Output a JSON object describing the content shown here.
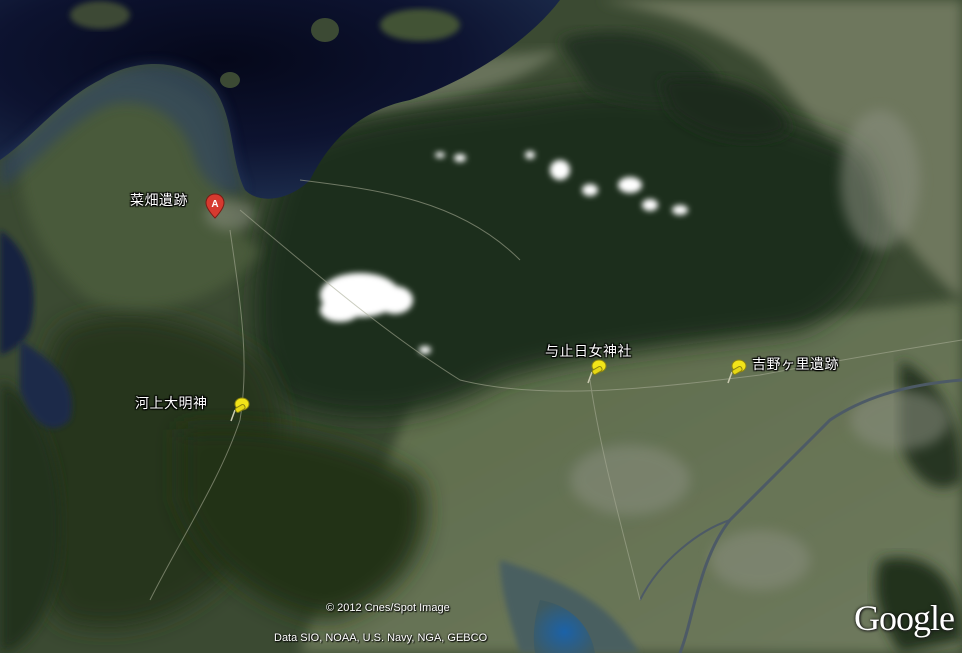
{
  "map": {
    "imagery_type": "satellite",
    "places": [
      {
        "id": "nabatake",
        "label": "菜畑遺跡",
        "marker": "red-pin-A"
      },
      {
        "id": "yodohime",
        "label": "与止日女神社",
        "marker": "yellow-pushpin"
      },
      {
        "id": "yoshinogari",
        "label": "吉野ヶ里遺跡",
        "marker": "yellow-pushpin"
      },
      {
        "id": "kawakami",
        "label": "河上大明神",
        "marker": "yellow-pushpin"
      }
    ],
    "marker_letter": "A",
    "colors": {
      "marker_red": "#d63a2f",
      "pushpin_yellow": "#f2e419",
      "sea_dark": "#0a0d22",
      "forest_dark": "#233320",
      "plain_green": "#5d6b4c"
    }
  },
  "credits": {
    "imagery": "© 2012 Cnes/Spot Image",
    "data": "Data SIO, NOAA, U.S. Navy, NGA, GEBCO"
  },
  "logo": {
    "text": "Google"
  }
}
